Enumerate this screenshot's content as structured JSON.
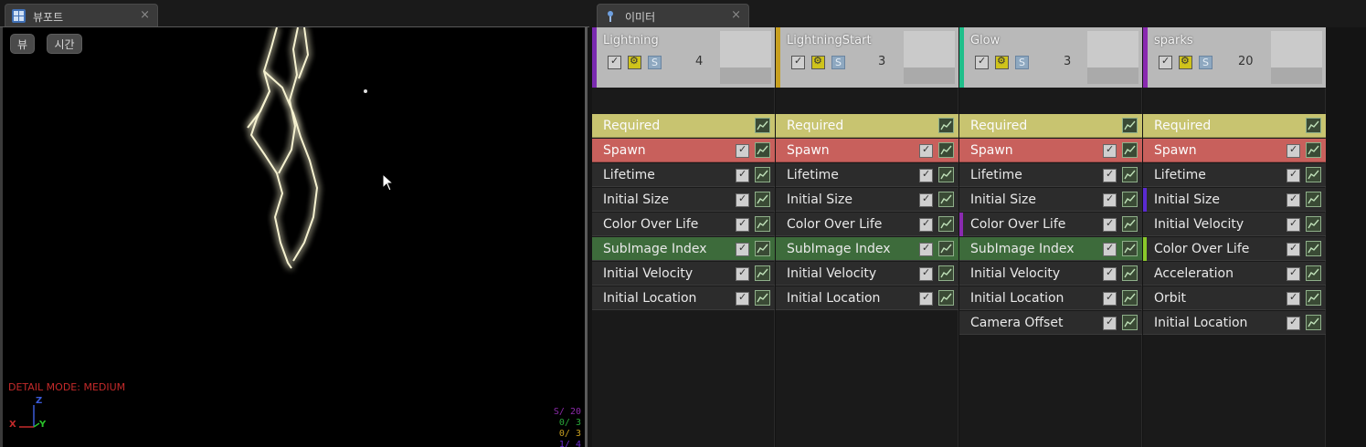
{
  "tabs": {
    "viewport": {
      "label": "뷰포트",
      "close": "×"
    },
    "emitters": {
      "label": "이미터",
      "close": "×"
    }
  },
  "viewport": {
    "view_button": "뷰",
    "time_button": "시간",
    "detail_mode": "DETAIL MODE: MEDIUM",
    "axis": {
      "z": "Z",
      "x": "X",
      "y": "Y"
    },
    "stats": [
      {
        "text": "S/ 20",
        "color": "#8a2aa8"
      },
      {
        "text": "0/ 3",
        "color": "#2aa83a"
      },
      {
        "text": "0/ 3",
        "color": "#c8a020"
      },
      {
        "text": "1/ 4",
        "color": "#6a2ad0"
      }
    ]
  },
  "emitters": [
    {
      "name": "Lightning",
      "count": "4",
      "color": "#7a2ab0",
      "modules": [
        {
          "label": "Required",
          "type": "required"
        },
        {
          "label": "Spawn",
          "type": "spawn"
        },
        {
          "label": "Lifetime",
          "type": "normal"
        },
        {
          "label": "Initial Size",
          "type": "normal"
        },
        {
          "label": "Color Over Life",
          "type": "normal"
        },
        {
          "label": "SubImage Index",
          "type": "subimg"
        },
        {
          "label": "Initial Velocity",
          "type": "normal"
        },
        {
          "label": "Initial Location",
          "type": "normal"
        }
      ]
    },
    {
      "name": "LightningStart",
      "count": "3",
      "color": "#c8a020",
      "modules": [
        {
          "label": "Required",
          "type": "required"
        },
        {
          "label": "Spawn",
          "type": "spawn"
        },
        {
          "label": "Lifetime",
          "type": "normal"
        },
        {
          "label": "Initial Size",
          "type": "normal"
        },
        {
          "label": "Color Over Life",
          "type": "normal"
        },
        {
          "label": "SubImage Index",
          "type": "subimg"
        },
        {
          "label": "Initial Velocity",
          "type": "normal"
        },
        {
          "label": "Initial Location",
          "type": "normal"
        }
      ]
    },
    {
      "name": "Glow",
      "count": "3",
      "color": "#1fbf8a",
      "modules": [
        {
          "label": "Required",
          "type": "required"
        },
        {
          "label": "Spawn",
          "type": "spawn"
        },
        {
          "label": "Lifetime",
          "type": "normal"
        },
        {
          "label": "Initial Size",
          "type": "normal"
        },
        {
          "label": "Color Over Life",
          "type": "normal",
          "marker": "#8a2ab0"
        },
        {
          "label": "SubImage Index",
          "type": "subimg"
        },
        {
          "label": "Initial Velocity",
          "type": "normal"
        },
        {
          "label": "Initial Location",
          "type": "normal"
        },
        {
          "label": "Camera Offset",
          "type": "normal"
        }
      ]
    },
    {
      "name": "sparks",
      "count": "20",
      "color": "#8a2ab0",
      "modules": [
        {
          "label": "Required",
          "type": "required"
        },
        {
          "label": "Spawn",
          "type": "spawn"
        },
        {
          "label": "Lifetime",
          "type": "normal"
        },
        {
          "label": "Initial Size",
          "type": "normal",
          "marker": "#5a2ad0"
        },
        {
          "label": "Initial Velocity",
          "type": "normal"
        },
        {
          "label": "Color Over Life",
          "type": "normal",
          "marker": "#8ac82a"
        },
        {
          "label": "Acceleration",
          "type": "normal"
        },
        {
          "label": "Orbit",
          "type": "normal"
        },
        {
          "label": "Initial Location",
          "type": "normal"
        }
      ]
    }
  ]
}
